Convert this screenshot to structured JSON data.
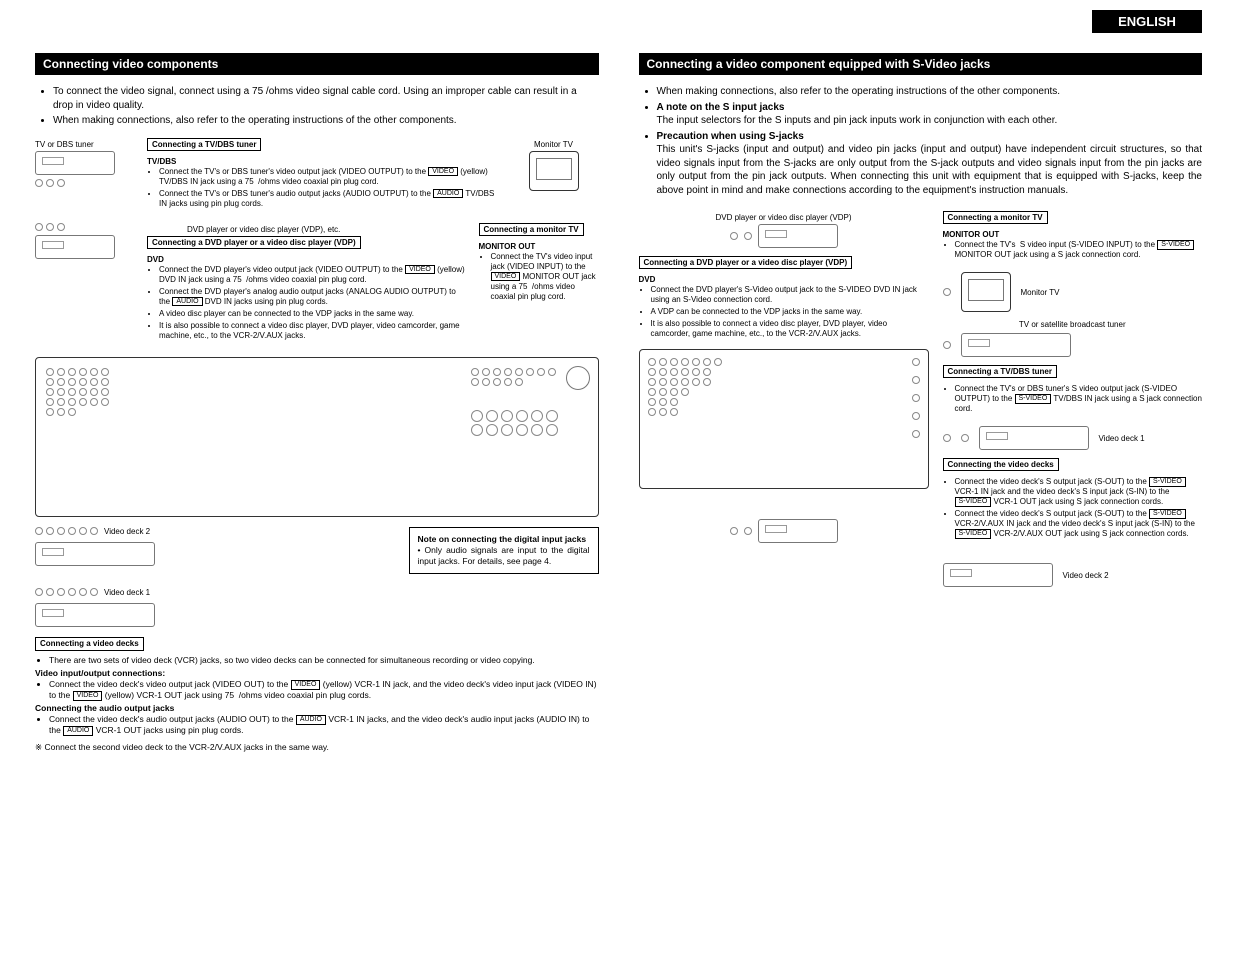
{
  "language_tag": "ENGLISH",
  "left": {
    "heading": "Connecting video components",
    "intro": [
      "To connect the video signal, connect using a 75   /ohms video signal cable cord. Using an improper cable can result in a drop in video quality.",
      "When making connections, also refer to the operating instructions of the other components."
    ],
    "labels": {
      "tv_dbs_tuner": "TV or DBS tuner",
      "monitor_tv": "Monitor TV",
      "dvd_caption": "DVD player or video disc player (VDP), etc.",
      "video_deck_1": "Video deck 1",
      "video_deck_2": "Video deck 2"
    },
    "box_tvdbs": {
      "title": "Connecting a TV/DBS tuner",
      "subhead": "TV/DBS",
      "items": [
        "Connect the TV's or DBS tuner's video output jack (VIDEO OUTPUT) to the [VIDEO] (yellow) TV/DBS IN jack using a 75   /ohms video coaxial pin plug cord.",
        "Connect the TV's or DBS tuner's audio output jacks (AUDIO OUTPUT) to the [AUDIO] TV/DBS IN jacks using pin plug cords."
      ]
    },
    "box_monitor": {
      "title": "Connecting a monitor TV",
      "subhead": "MONITOR OUT",
      "items": [
        "Connect the TV's video input jack (VIDEO INPUT) to the [VIDEO] MONITOR OUT jack using a 75   /ohms video coaxial pin plug cord."
      ]
    },
    "box_dvd": {
      "title": "Connecting a DVD player or a video disc player (VDP)",
      "subhead": "DVD",
      "items": [
        "Connect the DVD player's video output jack (VIDEO OUTPUT) to the [VIDEO] (yellow) DVD IN jack using a 75   /ohms video coaxial pin plug cord.",
        "Connect the DVD player's analog audio output jacks (ANALOG AUDIO OUTPUT) to the [AUDIO] DVD IN jacks using pin plug cords.",
        "A video disc player can be connected to the VDP jacks in the same way.",
        "It is also possible to connect a video disc player, DVD player, video camcorder, game machine, etc., to the VCR-2/V.AUX jacks."
      ]
    },
    "note_box": {
      "title": "Note on connecting the digital input jacks",
      "body": "Only audio signals are input to the digital input jacks. For details, see page 4."
    },
    "box_decks": {
      "title": "Connecting a video decks",
      "line1": "There are two sets of video deck (VCR) jacks, so two video decks can be connected for simultaneous recording or video copying.",
      "sub1": "Video input/output connections:",
      "item1": "Connect the video deck's video output jack (VIDEO OUT) to the [VIDEO] (yellow) VCR-1 IN jack, and the video deck's video input jack (VIDEO IN) to the [VIDEO] (yellow) VCR-1 OUT jack using 75   /ohms video coaxial pin plug cords.",
      "sub2": "Connecting the audio output jacks",
      "item2": "Connect the video deck's audio output jacks (AUDIO OUT) to the [AUDIO] VCR-1 IN jacks, and the video deck's audio input jacks (AUDIO IN) to the [AUDIO] VCR-1 OUT jacks using pin plug cords.",
      "star": "Connect the second video deck to the VCR-2/V.AUX jacks in the same way."
    }
  },
  "right": {
    "heading": "Connecting a video component equipped with S-Video jacks",
    "intro": [
      "When making connections, also refer to the operating instructions of the other components."
    ],
    "note_s_head": "A note on the S input jacks",
    "note_s_body": "The input selectors for the S inputs and pin jack inputs work in conjunction with each other.",
    "precaution_head": "Precaution when using S-jacks",
    "precaution_body": "This unit's S-jacks (input and output) and video pin jacks (input and output) have independent circuit structures, so that video signals input  from the S-jacks are only output from the S-jack outputs and video signals input from the pin jacks are only output from the pin jack outputs.\nWhen connecting this unit with equipment that is equipped with S-jacks, keep the above point in mind and make connections according to the equipment's instruction manuals.",
    "labels": {
      "dvd_caption": "DVD player or video disc player (VDP)",
      "monitor_tv": "Monitor TV",
      "sat_tuner": "TV or satellite broadcast tuner",
      "video_deck_1": "Video deck 1",
      "video_deck_2": "Video deck 2"
    },
    "box_monitor": {
      "title": "Connecting a monitor TV",
      "subhead": "MONITOR OUT",
      "items": [
        "Connect the TV's  S video input (S-VIDEO INPUT) to the [S-VIDEO] MONITOR OUT jack using a S jack connection cord."
      ]
    },
    "box_dvd": {
      "title": "Connecting a DVD player or a video disc player (VDP)",
      "subhead": "DVD",
      "items": [
        "Connect the DVD player's S-Video output jack to the S-VIDEO DVD IN jack using an S-Video connection cord.",
        "A VDP can be connected to the VDP jacks in the same way.",
        "It is also possible to connect a video disc player, DVD player, video camcorder, game machine, etc., to the VCR-2/V.AUX jacks."
      ]
    },
    "box_tvdbs": {
      "title": "Connecting a TV/DBS tuner",
      "items": [
        "Connect the TV's or DBS tuner's S video output jack (S-VIDEO OUTPUT) to the [S-VIDEO] TV/DBS IN jack using a S jack connection cord."
      ]
    },
    "box_decks": {
      "title": "Connecting the video decks",
      "items": [
        "Connect the video deck's S output jack (S-OUT) to the [S-VIDEO] VCR-1 IN jack and the video deck's S input jack (S-IN) to the [S-VIDEO] VCR-1 OUT jack using S jack connection cords.",
        "Connect the video deck's S output jack (S-OUT) to the [S-VIDEO] VCR-2/V.AUX IN jack and the video deck's S input jack (S-IN) to the [S-VIDEO] VCR-2/V.AUX OUT jack using S jack connection cords."
      ]
    }
  },
  "chips": {
    "video": "VIDEO",
    "audio": "AUDIO",
    "svideo": "S-VIDEO"
  }
}
